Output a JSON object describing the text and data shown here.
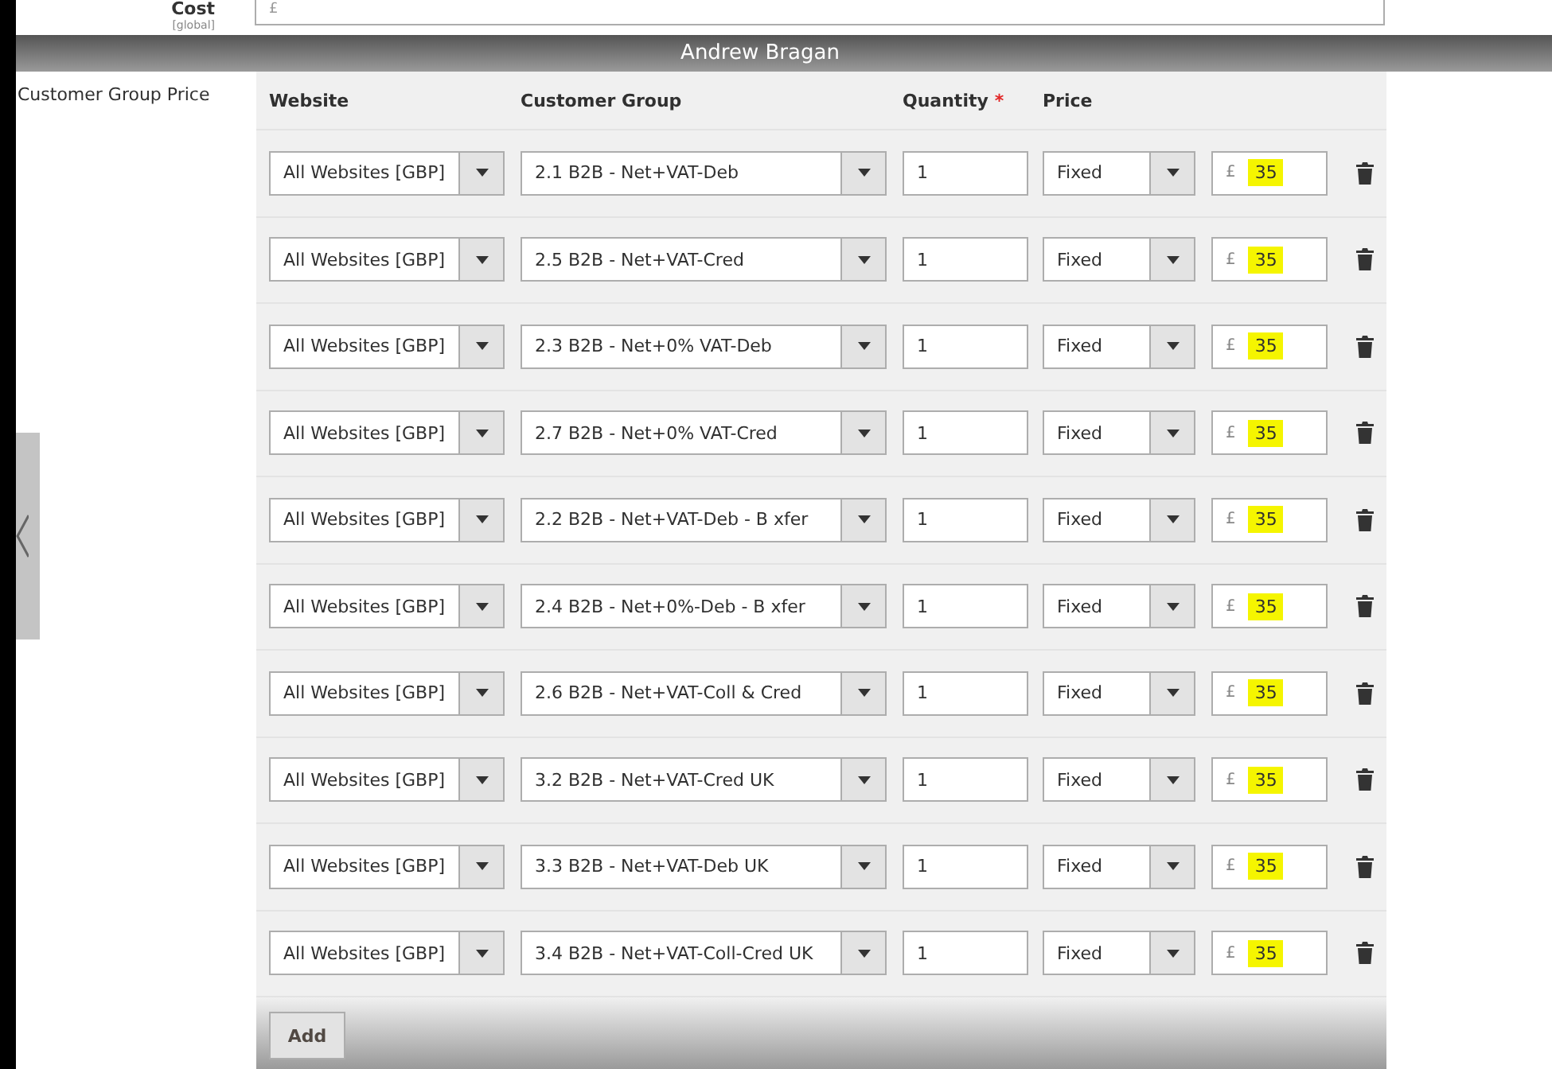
{
  "cost": {
    "label": "Cost",
    "scope": "[global]",
    "value": "£"
  },
  "presenter": {
    "name": "Andrew Bragan"
  },
  "section": {
    "label": "Customer Group Price"
  },
  "table": {
    "columns": [
      {
        "label": "Website"
      },
      {
        "label": "Customer Group"
      },
      {
        "label": "Quantity",
        "required_mark": "*"
      },
      {
        "label": "Price"
      }
    ],
    "rows": [
      {
        "website": "All Websites [GBP]",
        "group": "2.1 B2B - Net+VAT-Deb",
        "quantity": "1",
        "price_type": "Fixed",
        "currency": "£",
        "price": "35",
        "highlighted": true
      },
      {
        "website": "All Websites [GBP]",
        "group": "2.5 B2B - Net+VAT-Cred",
        "quantity": "1",
        "price_type": "Fixed",
        "currency": "£",
        "price": "35",
        "highlighted": true
      },
      {
        "website": "All Websites [GBP]",
        "group": "2.3 B2B - Net+0% VAT-Deb",
        "quantity": "1",
        "price_type": "Fixed",
        "currency": "£",
        "price": "35",
        "highlighted": true
      },
      {
        "website": "All Websites [GBP]",
        "group": "2.7 B2B - Net+0% VAT-Cred",
        "quantity": "1",
        "price_type": "Fixed",
        "currency": "£",
        "price": "35",
        "highlighted": true
      },
      {
        "website": "All Websites [GBP]",
        "group": "2.2 B2B - Net+VAT-Deb - B xfer",
        "quantity": "1",
        "price_type": "Fixed",
        "currency": "£",
        "price": "35",
        "highlighted": true
      },
      {
        "website": "All Websites [GBP]",
        "group": "2.4 B2B - Net+0%-Deb - B xfer",
        "quantity": "1",
        "price_type": "Fixed",
        "currency": "£",
        "price": "35",
        "highlighted": true
      },
      {
        "website": "All Websites [GBP]",
        "group": "2.6 B2B - Net+VAT-Coll & Cred",
        "quantity": "1",
        "price_type": "Fixed",
        "currency": "£",
        "price": "35",
        "highlighted": true
      },
      {
        "website": "All Websites [GBP]",
        "group": "3.2 B2B - Net+VAT-Cred UK",
        "quantity": "1",
        "price_type": "Fixed",
        "currency": "£",
        "price": "35",
        "highlighted": true
      },
      {
        "website": "All Websites [GBP]",
        "group": "3.3 B2B - Net+VAT-Deb UK",
        "quantity": "1",
        "price_type": "Fixed",
        "currency": "£",
        "price": "35",
        "highlighted": true
      },
      {
        "website": "All Websites [GBP]",
        "group": "3.4 B2B - Net+VAT-Coll-Cred UK",
        "quantity": "1",
        "price_type": "Fixed",
        "currency": "£",
        "price": "35",
        "highlighted": true
      }
    ]
  },
  "add_button": {
    "label": "Add"
  }
}
